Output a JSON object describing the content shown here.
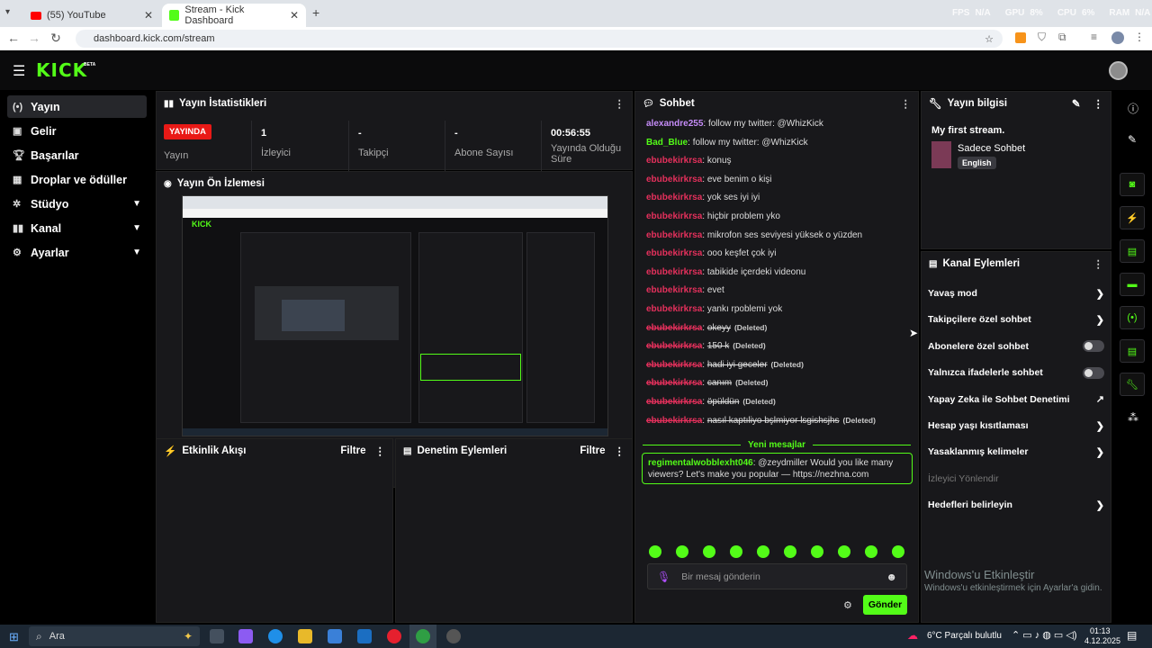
{
  "browser": {
    "tab1_title": "(55) YouTube",
    "tab2_title": "Stream - Kick Dashboard",
    "url": "dashboard.kick.com/stream",
    "overlay": [
      "FPS",
      "N/A",
      "GPU",
      "8%",
      "CPU",
      "6%",
      "RAM",
      "N/A"
    ]
  },
  "brand": {
    "logo": "KICK",
    "beta": "BETA",
    "accent": "#53fc18"
  },
  "sidebar": {
    "items": [
      {
        "icon": "broadcast-icon",
        "label": "Yayın"
      },
      {
        "icon": "wallet-icon",
        "label": "Gelir"
      },
      {
        "icon": "trophy-icon",
        "label": "Başarılar"
      },
      {
        "icon": "gift-icon",
        "label": "Droplar ve ödüller"
      },
      {
        "icon": "gear-icon",
        "label": "Stüdyo"
      },
      {
        "icon": "channel-icon",
        "label": "Kanal"
      },
      {
        "icon": "settings-icon",
        "label": "Ayarlar"
      }
    ]
  },
  "stats": {
    "title": "Yayın İstatistikleri",
    "live_badge": "YAYINDA",
    "live_label": "Yayın",
    "viewers_value": "1",
    "viewers_label": "İzleyici",
    "followers_value": "-",
    "followers_label": "Takipçi",
    "subs_value": "-",
    "subs_label": "Abone Sayısı",
    "uptime_value": "00:56:55",
    "uptime_label": "Yayında Olduğu Süre"
  },
  "preview": {
    "title": "Yayın Ön İzlemesi"
  },
  "activity": {
    "title": "Etkinlik Akışı",
    "filter": "Filtre"
  },
  "moderation": {
    "title": "Denetim Eylemleri",
    "filter": "Filtre"
  },
  "chat": {
    "title": "Sohbet",
    "messages": [
      {
        "user": "alexandre255",
        "text": "follow my twitter: @WhizKick",
        "color": "#c58cf8",
        "deleted": false
      },
      {
        "user": "Bad_Blue",
        "text": "follow my twitter: @WhizKick",
        "color": "#53fc18",
        "deleted": false
      },
      {
        "user": "ebubekirkrsa",
        "text": "konuş",
        "color": "#e5305c",
        "deleted": false
      },
      {
        "user": "ebubekirkrsa",
        "text": "eve benim o kişi",
        "color": "#e5305c",
        "deleted": false
      },
      {
        "user": "ebubekirkrsa",
        "text": "yok ses iyi iyi",
        "color": "#e5305c",
        "deleted": false
      },
      {
        "user": "ebubekirkrsa",
        "text": "hiçbir problem yko",
        "color": "#e5305c",
        "deleted": false
      },
      {
        "user": "ebubekirkrsa",
        "text": "mikrofon ses seviyesi yüksek o yüzden",
        "color": "#e5305c",
        "deleted": false
      },
      {
        "user": "ebubekirkrsa",
        "text": "ooo keşfet çok iyi",
        "color": "#e5305c",
        "deleted": false
      },
      {
        "user": "ebubekirkrsa",
        "text": "tabikide içerdeki videonu",
        "color": "#e5305c",
        "deleted": false
      },
      {
        "user": "ebubekirkrsa",
        "text": "evet",
        "color": "#e5305c",
        "deleted": false
      },
      {
        "user": "ebubekirkrsa",
        "text": "yankı rpoblemi yok",
        "color": "#e5305c",
        "deleted": false
      },
      {
        "user": "ebubekirkrsa",
        "text": "okeyy",
        "color": "#e5305c",
        "deleted": true
      },
      {
        "user": "ebubekirkrsa",
        "text": "150 k",
        "color": "#e5305c",
        "deleted": true
      },
      {
        "user": "ebubekirkrsa",
        "text": "hadi iyi geceler",
        "color": "#e5305c",
        "deleted": true
      },
      {
        "user": "ebubekirkrsa",
        "text": "canım",
        "color": "#e5305c",
        "deleted": true
      },
      {
        "user": "ebubekirkrsa",
        "text": "öpüldün",
        "color": "#e5305c",
        "deleted": true
      },
      {
        "user": "ebubekirkrsa",
        "text": "nasıl kaptıliyo bşlmiyor lsgishsjhs",
        "color": "#e5305c",
        "deleted": true
      }
    ],
    "deleted_tag": "(Deleted)",
    "new_messages": "Yeni mesajlar",
    "highlight_user": "regimentalwobblexht046",
    "highlight_text": "@zeydmiller Would you like many viewers? Let's make you popular — https://nezhna.com",
    "input_placeholder": "Bir mesaj gönderin",
    "send": "Gönder"
  },
  "stream_info": {
    "title": "Yayın bilgisi",
    "stream_title": "My first stream.",
    "category": "Sadece Sohbet",
    "language": "English"
  },
  "channel_actions": {
    "title": "Kanal Eylemleri",
    "items": [
      {
        "label": "Yavaş mod",
        "control": "chevron"
      },
      {
        "label": "Takipçilere özel sohbet",
        "control": "chevron"
      },
      {
        "label": "Abonelere özel sohbet",
        "control": "toggle"
      },
      {
        "label": "Yalnızca ifadelerle sohbet",
        "control": "toggle"
      },
      {
        "label": "Yapay Zeka ile Sohbet Denetimi",
        "control": "external"
      },
      {
        "label": "Hesap yaşı kısıtlaması",
        "control": "chevron"
      },
      {
        "label": "Yasaklanmış kelimeler",
        "control": "chevron"
      },
      {
        "label": "İzleyici Yönlendir",
        "control": "none"
      },
      {
        "label": "Hedefleri belirleyin",
        "control": "chevron"
      }
    ]
  },
  "watermark": {
    "line1": "Windows'u Etkinleştir",
    "line2": "Windows'u etkinleştirmek için Ayarlar'a gidin."
  },
  "taskbar": {
    "search": "Ara",
    "weather": "6°C  Parçalı bulutlu",
    "time": "01:13",
    "date": "4.12.2025"
  }
}
